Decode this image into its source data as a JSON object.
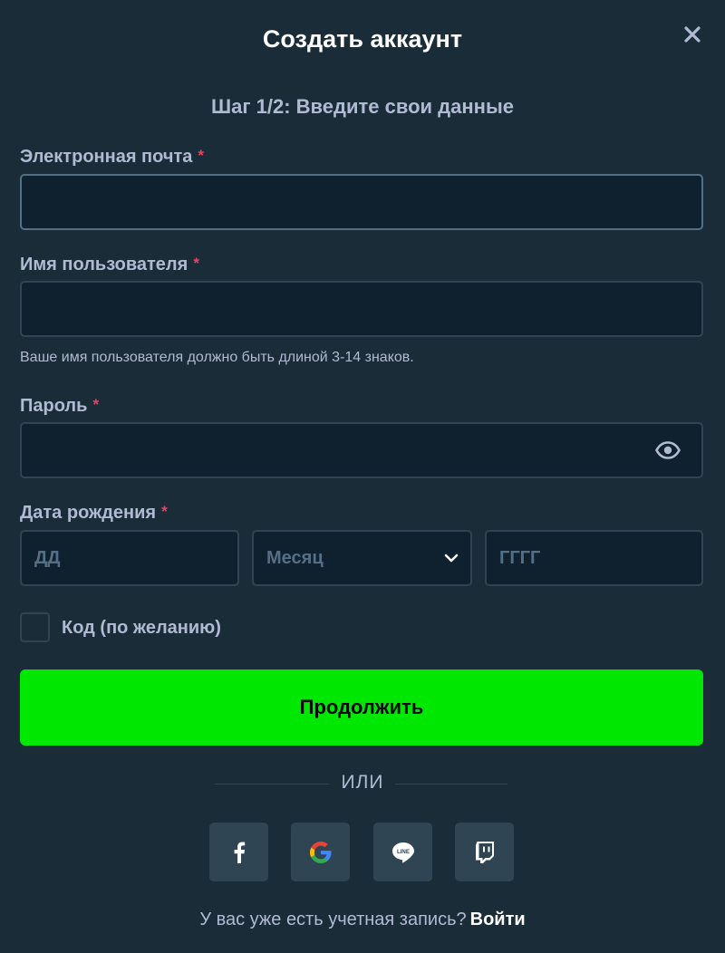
{
  "header": {
    "title": "Создать аккаунт",
    "close_icon": "close-icon",
    "step": "Шаг 1/2: Введите свои данные"
  },
  "form": {
    "email": {
      "label": "Электронная почта",
      "required_mark": "*",
      "value": ""
    },
    "username": {
      "label": "Имя пользователя",
      "required_mark": "*",
      "value": "",
      "hint": "Ваше имя пользователя должно быть длиной 3-14 знаков."
    },
    "password": {
      "label": "Пароль",
      "required_mark": "*",
      "value": "",
      "toggle_icon": "eye-icon"
    },
    "dob": {
      "label": "Дата рождения",
      "required_mark": "*",
      "day_placeholder": "ДД",
      "month_value": "Месяц",
      "year_placeholder": "ГГГГ"
    },
    "code_checkbox": {
      "label": "Код (по желанию)",
      "checked": false
    }
  },
  "actions": {
    "continue_label": "Продолжить",
    "divider": "ИЛИ"
  },
  "social": [
    {
      "name": "facebook",
      "icon": "facebook-icon"
    },
    {
      "name": "google",
      "icon": "google-icon"
    },
    {
      "name": "line",
      "icon": "line-icon",
      "text": "LINE"
    },
    {
      "name": "twitch",
      "icon": "twitch-icon"
    }
  ],
  "footer": {
    "prompt": "У вас уже есть учетная запись?",
    "login_label": "Войти"
  },
  "colors": {
    "background": "#1a2c38",
    "input_bg": "#0f212e",
    "border": "#2f4553",
    "accent_green": "#00e701",
    "required": "#ed4163"
  }
}
